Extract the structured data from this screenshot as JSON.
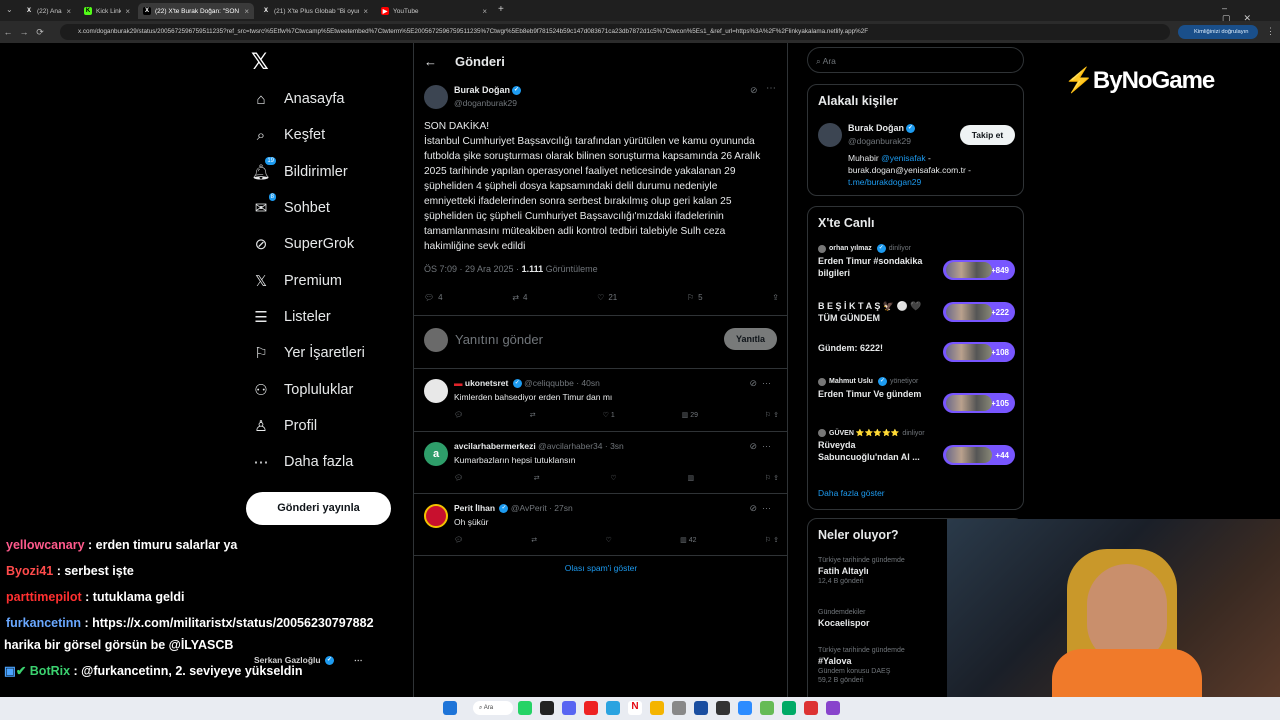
{
  "browser": {
    "tabs": [
      {
        "label": "(22) Ana",
        "icon": "x-logo-icon"
      },
      {
        "label": "Kick Link",
        "icon": "k-icon"
      },
      {
        "label": "(22) X'te Burak Doğan: \"SON D",
        "icon": "x-logo-icon"
      },
      {
        "label": "(21) X'te Plus Globab \"Bi oyun o",
        "icon": "x-logo-icon"
      },
      {
        "label": "YouTube",
        "icon": "youtube-icon"
      }
    ],
    "url": "x.com/doganburak29/status/2005672596759511235?ref_src=twsrc%5Etfw%7Ctwcamp%5Etweetembed%7Ctwterm%5E2005672596759511235%7Ctwgr%5Eb8eb9f781524b59c147d083671ca23db7872d1c5%7Ctwcon%5Es1_&ref_url=https%3A%2F%2Flinkyakalama.netlify.app%2F",
    "verify_label": "Kimliğinizi doğrulayın"
  },
  "nav": {
    "items": [
      {
        "label": "Anasayfa",
        "icon": "home-icon"
      },
      {
        "label": "Keşfet",
        "icon": "search-icon"
      },
      {
        "label": "Bildirimler",
        "icon": "bell-icon",
        "badge": "19"
      },
      {
        "label": "Sohbet",
        "icon": "mail-icon",
        "badge": "8"
      },
      {
        "label": "SuperGrok",
        "icon": "grok-icon"
      },
      {
        "label": "Premium",
        "icon": "x-logo-icon"
      },
      {
        "label": "Listeler",
        "icon": "list-icon"
      },
      {
        "label": "Yer İşaretleri",
        "icon": "bookmark-icon"
      },
      {
        "label": "Topluluklar",
        "icon": "people-icon"
      },
      {
        "label": "Profil",
        "icon": "person-icon"
      },
      {
        "label": "Daha fazla",
        "icon": "more-circle-icon"
      }
    ],
    "post_button": "Gönderi yayınla"
  },
  "post": {
    "header_title": "Gönderi",
    "author_name": "Burak Doğan",
    "author_handle": "@doganburak29",
    "text": "SON DAKİKA!\nİstanbul Cumhuriyet Başsavcılığı tarafından yürütülen ve kamu oyununda futbolda şike soruşturması olarak bilinen soruşturma kapsamında 26 Aralık 2025 tarihinde yapılan operasyonel faaliyet neticesinde yakalanan 29 şüpheliden 4 şüpheli dosya kapsamındaki delil durumu nedeniyle emniyetteki ifadelerinden sonra serbest bırakılmış olup geri kalan 25 şüpheliden üç şüpheli Cumhuriyet Başsavcılığı'mızdaki ifadelerinin tamamlanmasını müteakiben adli kontrol tedbiri talebiyle Sulh ceza hakimliğine sevk edildi",
    "time": "ÖS 7:09 · 29 Ara 2025 · ",
    "views": "1.111",
    "views_label": " Görüntüleme",
    "stats": {
      "replies": "4",
      "reposts": "4",
      "likes": "21",
      "bookmarks": "5"
    },
    "reply_placeholder": "Yanıtını gönder",
    "reply_button": "Yanıtla"
  },
  "comments": [
    {
      "name": "ukonetsret",
      "handle": "@celiqqubbe",
      "time": "· 40sn",
      "text": "Kimlerden bahsediyor erden Timur dan mı",
      "replies": "",
      "reposts": "",
      "likes": "1",
      "views": "29",
      "avatar_color": "#e8e8e8"
    },
    {
      "name": "avcilarhabermerkezi",
      "handle": "@avcilarhaber34",
      "time": "· 3sn",
      "text": "Kumarbazların hepsi tutuklansın",
      "replies": "",
      "reposts": "",
      "likes": "",
      "views": "",
      "avatar_color": "#2e9e6a",
      "initial": "a"
    },
    {
      "name": "Perit İlhan",
      "handle": "@AvPerit",
      "time": "· 27sn",
      "text": "Oh şükür",
      "replies": "",
      "reposts": "",
      "likes": "",
      "views": "42",
      "avatar_color": "#c8102e"
    }
  ],
  "show_spam": "Olası spam'i göster",
  "right": {
    "search_placeholder": "Ara",
    "related_title": "Alakalı kişiler",
    "related": {
      "name": "Burak Doğan",
      "handle": "@doganburak29",
      "follow": "Takip et",
      "bio_prefix": "Muhabir ",
      "bio_link": "@yenisafak",
      "bio_mid": " - burak.dogan@yenisafak.com.tr - ",
      "bio_link2": "t.me/burakdogan29"
    },
    "live_title": "X'te Canlı",
    "live": [
      {
        "user": "orhan yılmaz",
        "status": "dinliyor",
        "title": "Erden Timur #sondakika bilgileri",
        "count": "+849"
      },
      {
        "user": "",
        "status": "",
        "title": "B E Ş İ K T A Ş 🦅 ⚪ 🖤 TÜM GÜNDEM",
        "count": "+222"
      },
      {
        "user": "",
        "status": "",
        "title": "Gündem: 6222!",
        "count": "+108"
      },
      {
        "user": "Mahmut Uslu",
        "status": "yönetiyor",
        "title": "Erden Timur Ve gündem",
        "count": "+105"
      },
      {
        "user": "GÜVEN ⭐⭐⭐⭐⭐",
        "status": "dinliyor",
        "title": "Rüveyda Sabuncuoğlu'ndan Al ...",
        "count": "+44"
      }
    ],
    "live_more": "Daha fazla göster",
    "trends_title": "Neler oluyor?",
    "trends": [
      {
        "sub": "Türkiye tarihinde gündemde",
        "title": "Fatih Altaylı",
        "count": "12,4 B gönderi"
      },
      {
        "sub": "Gündemdekiler",
        "title": "Kocaelispor",
        "count": ""
      },
      {
        "sub": "Türkiye tarihinde gündemde",
        "title": "#Yalova",
        "count": "Gündem konusu DAEŞ"
      },
      {
        "sub": "",
        "title": "",
        "count": "59,2 B gönderi"
      }
    ]
  },
  "overlay": {
    "brand": "ByNoGame",
    "chat": [
      {
        "user": "yellowcanary",
        "color": "#ff5a8c",
        "msg": " : erden timuru salarlar ya"
      },
      {
        "user": "Byozi41",
        "color": "#ff4b4b",
        "msg": " : serbest işte"
      },
      {
        "user": "parttimepilot",
        "color": "#ff3030",
        "msg": " : tutuklama geldi"
      },
      {
        "user": "furkancetinn",
        "color": "#6aa8ff",
        "msg": " : https://x.com/militaristx/status/20056230797882"
      },
      {
        "user": "",
        "color": "#ffffff",
        "msg": "harika bir görsel görsün be @İLYASCB"
      },
      {
        "user": "BotRix",
        "color": "#3bd16f",
        "msg": " : @furkancetinn, 2. seviyeye yükseldin"
      }
    ],
    "account_switcher": "Serkan Gazloğlu"
  },
  "taskbar": {
    "search": "Ara"
  },
  "colors": {
    "accent": "#1d9bf0",
    "live_pill": "#7856ff",
    "background": "#000000"
  }
}
